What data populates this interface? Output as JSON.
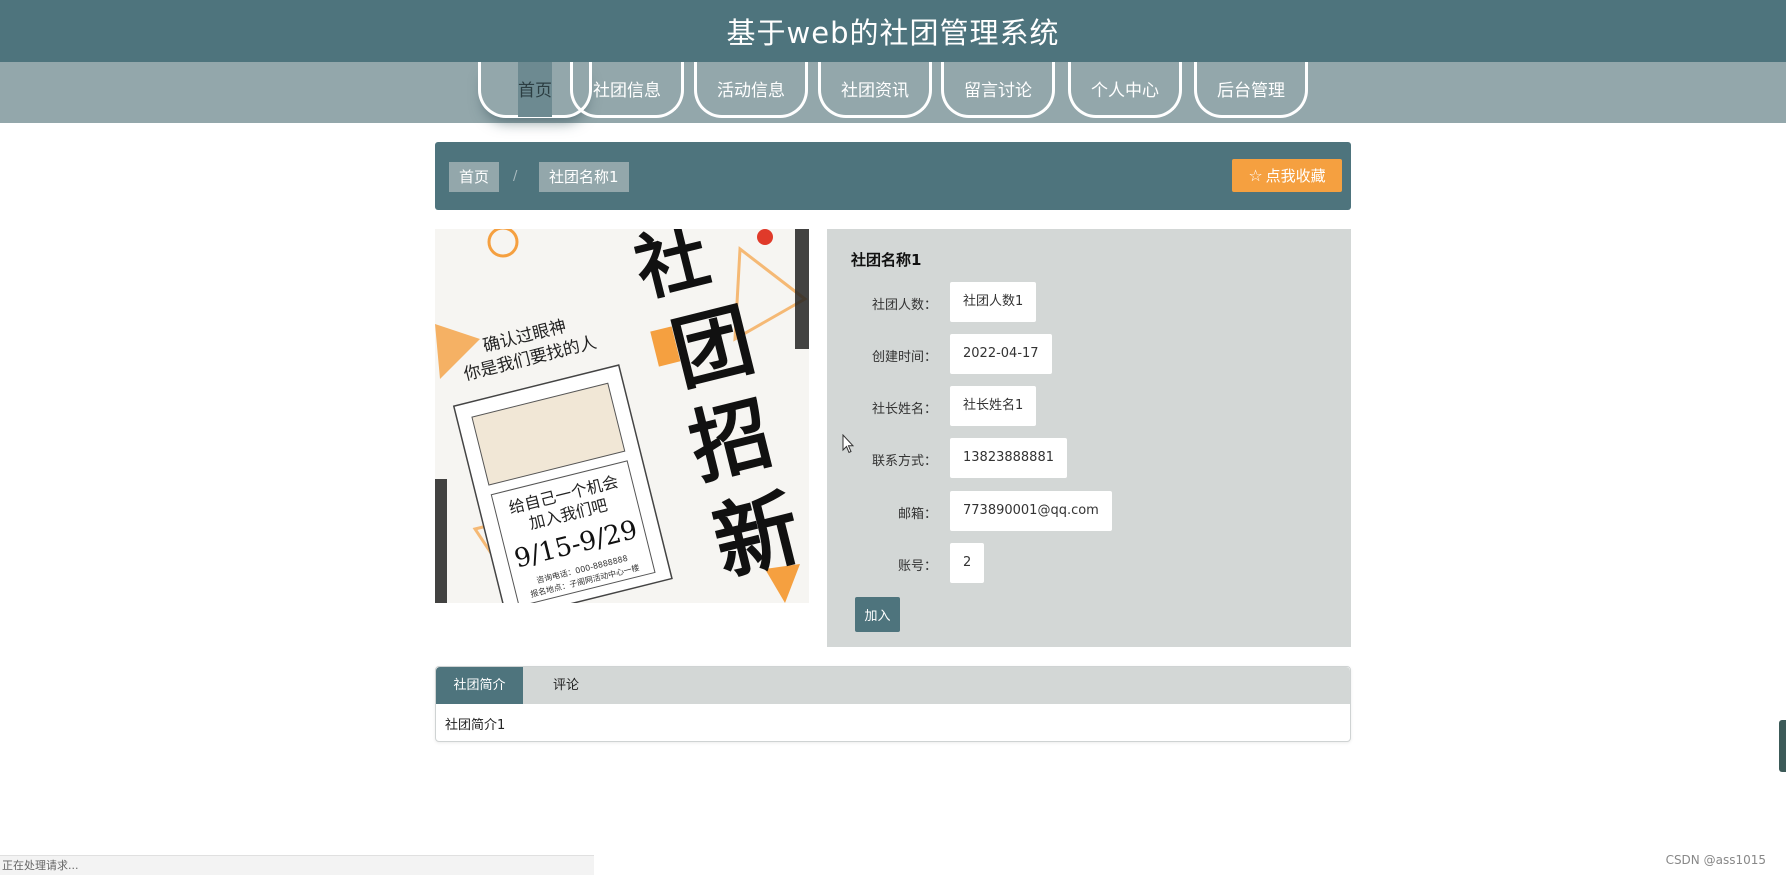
{
  "header": {
    "title": "基于web的社团管理系统"
  },
  "nav": {
    "items": [
      {
        "label": "首页"
      },
      {
        "label": "社团信息"
      },
      {
        "label": "活动信息"
      },
      {
        "label": "社团资讯"
      },
      {
        "label": "留言讨论"
      },
      {
        "label": "个人中心"
      },
      {
        "label": "后台管理"
      }
    ],
    "active_index": 0
  },
  "breadcrumb": {
    "home": "首页",
    "separator": "/",
    "current": "社团名称1"
  },
  "favorite_button": {
    "icon": "star-icon",
    "label": "点我收藏"
  },
  "poster": {
    "title_chars": [
      "社",
      "团",
      "招",
      "新"
    ],
    "subtitle_1": "确认过眼神",
    "subtitle_2": "你是我们要找的人",
    "slogan_1": "给自己一个机会",
    "slogan_2": "加入我们吧",
    "dates": "9/15-9/29",
    "contact_1": "咨询电话：000-8888888",
    "contact_2": "报名地点：子阁网活动中心一楼"
  },
  "club": {
    "name": "社团名称1",
    "fields": [
      {
        "label": "社团人数：",
        "value": "社团人数1"
      },
      {
        "label": "创建时间：",
        "value": "2022-04-17"
      },
      {
        "label": "社长姓名：",
        "value": "社长姓名1"
      },
      {
        "label": "联系方式：",
        "value": "13823888881"
      },
      {
        "label": "邮箱：",
        "value": "773890001@qq.com"
      },
      {
        "label": "账号：",
        "value": "2"
      }
    ],
    "join_label": "加入"
  },
  "tabs": {
    "items": [
      {
        "label": "社团简介"
      },
      {
        "label": "评论"
      }
    ],
    "active_index": 0,
    "content": "社团简介1"
  },
  "status_bar": {
    "text": "正在处理请求..."
  },
  "watermark": "CSDN @ass1015",
  "colors": {
    "primary": "#4e747d",
    "nav_bg": "#93a7ab",
    "panel_bg": "#d3d7d6",
    "accent": "#f5a040"
  }
}
